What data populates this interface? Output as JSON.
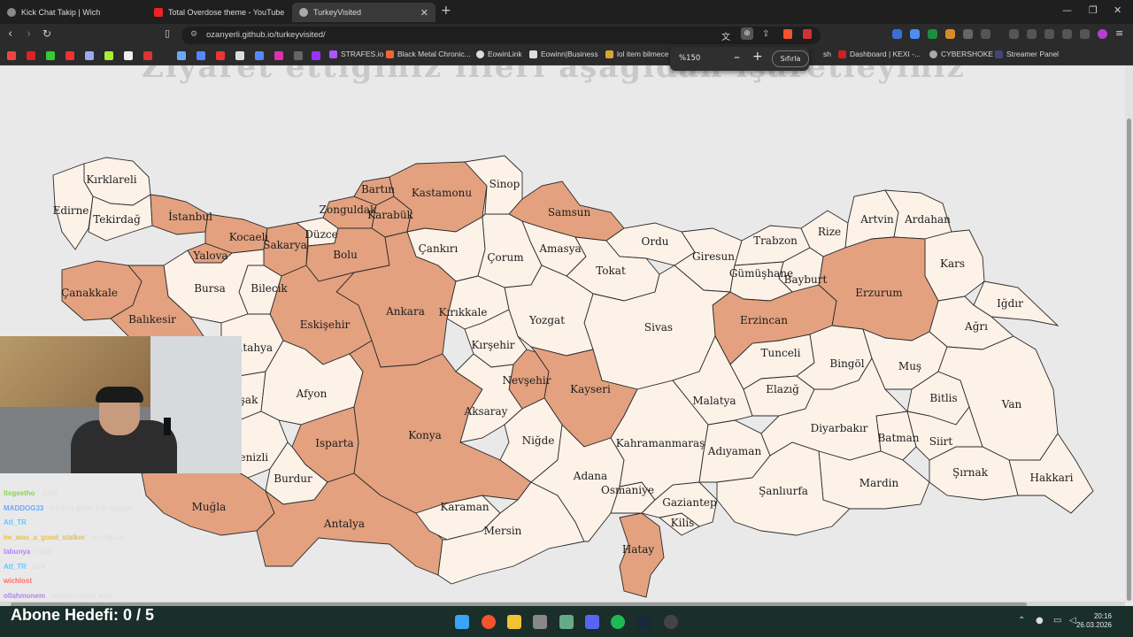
{
  "browser": {
    "tabs": [
      {
        "title": "Kick Chat Takip | Wich"
      },
      {
        "title": "Total Overdose theme - YouTube"
      },
      {
        "title": "TurkeyVisited",
        "active": true
      }
    ],
    "url": "ozanyerli.github.io/turkeyvisited/",
    "bookmarks": [
      "STRAFES.io",
      "Black Metal Chronic...",
      "EowinLink",
      "Eowinn|Business",
      "lol item bilmece",
      "sh",
      "Dashboard | KEXI -...",
      "CYBERSHOKE",
      "Streamer Panel"
    ],
    "zoom_popup": {
      "level": "%150",
      "minus": "–",
      "plus": "+",
      "reset": "Sıfırla"
    }
  },
  "page": {
    "heading": "Ziyaret ettiğiniz illeri aşağıdan işaretleyiniz"
  },
  "provinces": {
    "kirklareli": "Kırklareli",
    "edirne": "Edirne",
    "tekirdag": "Tekirdağ",
    "istanbul": "İstanbul",
    "kocaeli": "Kocaeli",
    "yalova": "Yalova",
    "sakarya": "Sakarya",
    "duzce": "Düzce",
    "zonguldak": "Zonguldak",
    "bartin": "Bartın",
    "karabuk": "Karabük",
    "kastamonu": "Kastamonu",
    "sinop": "Sinop",
    "samsun": "Samsun",
    "bolu": "Bolu",
    "cankiri": "Çankırı",
    "corum": "Çorum",
    "amasya": "Amasya",
    "ordu": "Ordu",
    "giresun": "Giresun",
    "trabzon": "Trabzon",
    "rize": "Rize",
    "artvin": "Artvin",
    "ardahan": "Ardahan",
    "kars": "Kars",
    "igdir": "Iğdır",
    "agri": "Ağrı",
    "erzurum": "Erzurum",
    "bayburt": "Bayburt",
    "gumushane": "Gümüşhane",
    "tokat": "Tokat",
    "erzincan": "Erzincan",
    "sivas": "Sivas",
    "yozgat": "Yozgat",
    "kirikkale": "Kırıkkale",
    "ankara": "Ankara",
    "eskisehir": "Eskişehir",
    "bilecik": "Bilecik",
    "bursa": "Bursa",
    "canakkale": "Çanakkale",
    "balikesir": "Balıkesir",
    "kutahya": "Kütahya",
    "usak": "Uşak",
    "afyon": "Afyon",
    "denizli": "Denizli",
    "isparta": "Isparta",
    "burdur": "Burdur",
    "mugla": "Muğla",
    "antalya": "Antalya",
    "konya": "Konya",
    "kirsehir": "Kırşehir",
    "nevsehir": "Nevşehir",
    "kayseri": "Kayseri",
    "aksaray": "Aksaray",
    "nigde": "Niğde",
    "karaman": "Karaman",
    "mersin": "Mersin",
    "adana": "Adana",
    "osmaniye": "Osmaniye",
    "hatay": "Hatay",
    "kilis": "Kilis",
    "gaziantep": "Gaziantep",
    "kahramanmaras": "Kahramanmaraş",
    "adiyaman": "Adıyaman",
    "malatya": "Malatya",
    "tunceli": "Tunceli",
    "elazig": "Elazığ",
    "bingol": "Bingöl",
    "mus": "Muş",
    "bitlis": "Bitlis",
    "van": "Van",
    "hakkari": "Hakkari",
    "sirnak": "Şırnak",
    "siirt": "Siirt",
    "batman": "Batman",
    "diyarbakir": "Diyarbakır",
    "mardin": "Mardin",
    "sanliurfa": "Şanlıurfa"
  },
  "visited": [
    "istanbul",
    "kocaeli",
    "sakarya",
    "yalova",
    "zonguldak",
    "bartin",
    "karabuk",
    "kastamonu",
    "samsun",
    "bolu",
    "ankara",
    "eskisehir",
    "canakkale",
    "balikesir",
    "isparta",
    "mugla",
    "antalya",
    "konya",
    "nevsehir",
    "kayseri",
    "hatay",
    "erzincan",
    "erzurum"
  ],
  "colors": {
    "visited": "#e3a17f",
    "unvisited": "#fdf2e8",
    "background": "#e9e9e9"
  },
  "stream": {
    "chat": [
      {
        "user": "itsgeetho",
        "msg": ": upslli"
      },
      {
        "user": "MADDOG33",
        "msg": ": burdura gitme kral napcan"
      },
      {
        "user": "Atl_TR",
        "msg": ":"
      },
      {
        "user": "im_was_a_good_stalker",
        "msg": ": alo https://"
      },
      {
        "user": "labunya",
        "msg": ": ciğdir"
      },
      {
        "user": "Atl_TR",
        "msg": ": amk"
      },
      {
        "user": "wichlost",
        "msg": ":"
      },
      {
        "user": "ollahmonem",
        "msg": ": sürgün müsün amk"
      }
    ],
    "goal_label": "Abone Hedefi:",
    "goal_value": "0 / 5"
  },
  "taskbar": {
    "time": "20:16",
    "date": "26.03.2026"
  }
}
